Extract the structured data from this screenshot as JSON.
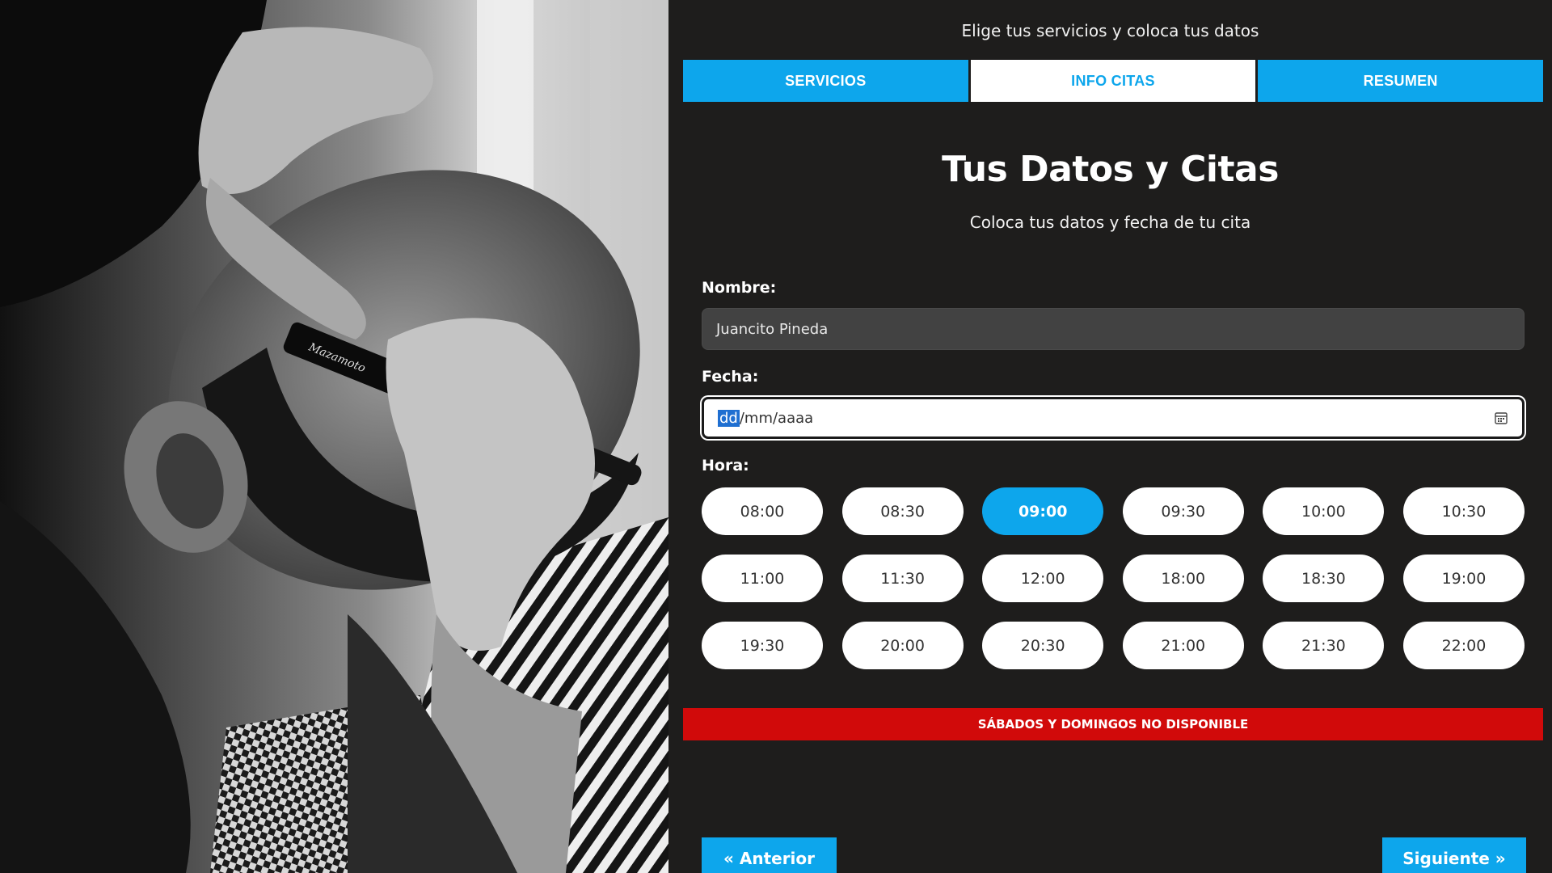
{
  "intro_text": "Elige tus servicios y coloca tus datos",
  "tabs": [
    {
      "label": "SERVICIOS",
      "active": false
    },
    {
      "label": "INFO CITAS",
      "active": true
    },
    {
      "label": "RESUMEN",
      "active": false
    }
  ],
  "section": {
    "title": "Tus Datos y Citas",
    "subtitle": "Coloca tus datos y fecha de tu cita"
  },
  "form": {
    "name_label": "Nombre:",
    "name_value": "Juancito Pineda",
    "date_label": "Fecha:",
    "date_dd": "dd",
    "date_rest": "/mm/aaaa",
    "hour_label": "Hora:"
  },
  "hours": [
    {
      "label": "08:00",
      "selected": false
    },
    {
      "label": "08:30",
      "selected": false
    },
    {
      "label": "09:00",
      "selected": true
    },
    {
      "label": "09:30",
      "selected": false
    },
    {
      "label": "10:00",
      "selected": false
    },
    {
      "label": "10:30",
      "selected": false
    },
    {
      "label": "11:00",
      "selected": false
    },
    {
      "label": "11:30",
      "selected": false
    },
    {
      "label": "12:00",
      "selected": false
    },
    {
      "label": "18:00",
      "selected": false
    },
    {
      "label": "18:30",
      "selected": false
    },
    {
      "label": "19:00",
      "selected": false
    },
    {
      "label": "19:30",
      "selected": false
    },
    {
      "label": "20:00",
      "selected": false
    },
    {
      "label": "20:30",
      "selected": false
    },
    {
      "label": "21:00",
      "selected": false
    },
    {
      "label": "21:30",
      "selected": false
    },
    {
      "label": "22:00",
      "selected": false
    }
  ],
  "alert_text": "SÁBADOS Y DOMINGOS NO DISPONIBLE",
  "nav": {
    "prev_label": "« Anterior",
    "next_label": "Siguiente »"
  },
  "colors": {
    "accent": "#0da6ec",
    "background": "#1e1d1c",
    "alert": "#d10a0a"
  },
  "icons": {
    "date_picker": "calendar-icon"
  }
}
